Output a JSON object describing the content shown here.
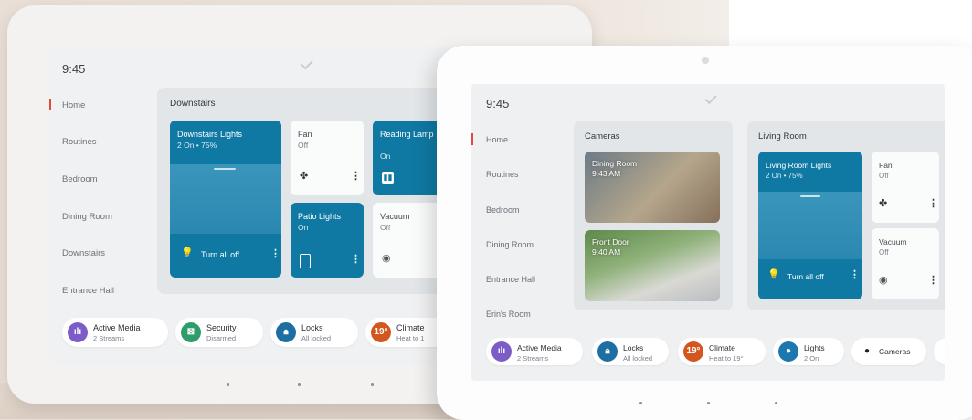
{
  "colors": {
    "teal": "#0f79a3",
    "nav_active": "#e04a3a",
    "media": "#7c5cc7",
    "security": "#2e9d6b",
    "locks": "#1d6fa3",
    "climate": "#d4561f",
    "lights": "#1a77b0"
  },
  "back": {
    "time": "9:45",
    "nav": [
      "Home",
      "Routines",
      "Bedroom",
      "Dining Room",
      "Downstairs",
      "Entrance Hall"
    ],
    "card_title": "Downstairs",
    "tiles": {
      "downstairs_lights": {
        "label": "Downstairs Lights",
        "status": "2 On • 75%",
        "action": "Turn all off"
      },
      "fan": {
        "label": "Fan",
        "status": "Off"
      },
      "reading_lamp": {
        "label": "Reading Lamp",
        "status": "On"
      },
      "patio_lights": {
        "label": "Patio Lights",
        "status": "On"
      },
      "vacuum": {
        "label": "Vacuum",
        "status": "Off"
      }
    },
    "pills": [
      {
        "title": "Active Media",
        "sub": "2 Streams",
        "icon": "bar-chart-icon"
      },
      {
        "title": "Security",
        "sub": "Disarmed",
        "icon": "shield-icon"
      },
      {
        "title": "Locks",
        "sub": "All locked",
        "icon": "lock-icon"
      },
      {
        "title": "Climate",
        "sub": "Heat to 1",
        "icon": "19°"
      }
    ]
  },
  "front": {
    "time": "9:45",
    "nav": [
      "Home",
      "Routines",
      "Bedroom",
      "Dining Room",
      "Entrance Hall",
      "Erin's Room"
    ],
    "cameras_title": "Cameras",
    "cam1": {
      "label": "Dining Room",
      "time": "9:43 AM"
    },
    "cam2": {
      "label": "Front Door",
      "time": "9:40 AM"
    },
    "living_title": "Living Room",
    "tiles": {
      "living_lights": {
        "label": "Living Room Lights",
        "status": "2 On • 75%",
        "action": "Turn all off"
      },
      "fan": {
        "label": "Fan",
        "status": "Off"
      },
      "vacuum": {
        "label": "Vacuum",
        "status": "Off"
      }
    },
    "pills": [
      {
        "title": "Active Media",
        "sub": "2 Streams"
      },
      {
        "title": "Locks",
        "sub": "All locked"
      },
      {
        "title": "Climate",
        "sub": "Heat to 19°",
        "badge": "19°"
      },
      {
        "title": "Lights",
        "sub": "2 On"
      },
      {
        "title": "Cameras",
        "sub": ""
      }
    ]
  }
}
